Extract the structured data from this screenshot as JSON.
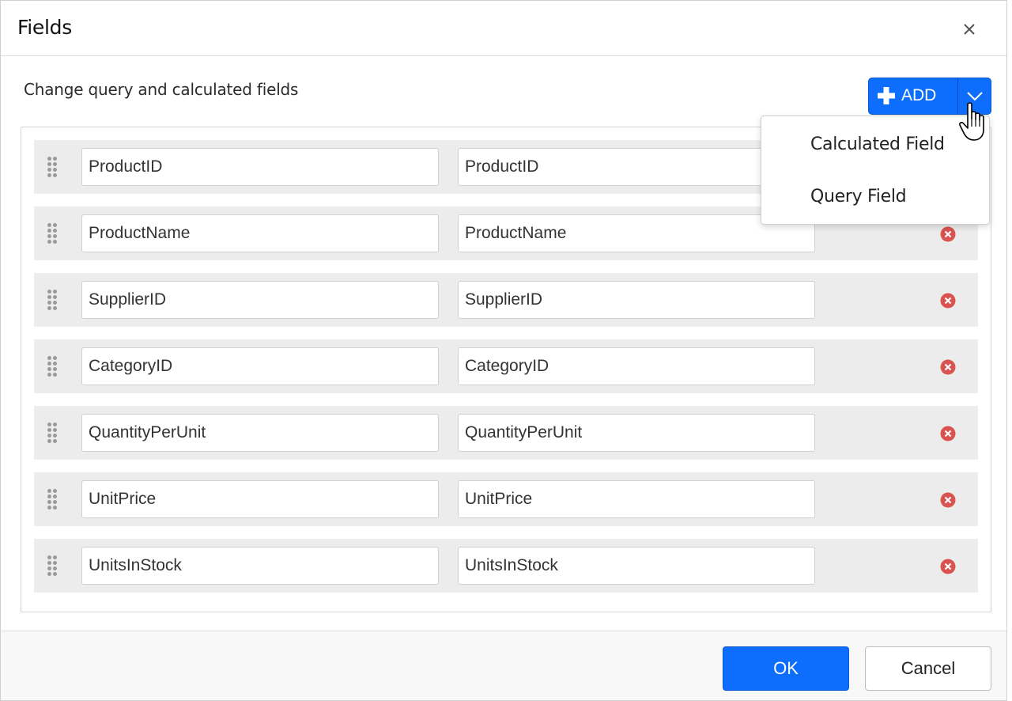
{
  "dialog": {
    "title": "Fields",
    "subtitle": "Change query and calculated fields"
  },
  "add_button": {
    "label": "ADD"
  },
  "dropdown": {
    "items": [
      {
        "label": "Calculated Field"
      },
      {
        "label": "Query Field"
      }
    ]
  },
  "fields": [
    {
      "name": "ProductID",
      "alias": "ProductID"
    },
    {
      "name": "ProductName",
      "alias": "ProductName"
    },
    {
      "name": "SupplierID",
      "alias": "SupplierID"
    },
    {
      "name": "CategoryID",
      "alias": "CategoryID"
    },
    {
      "name": "QuantityPerUnit",
      "alias": "QuantityPerUnit"
    },
    {
      "name": "UnitPrice",
      "alias": "UnitPrice"
    },
    {
      "name": "UnitsInStock",
      "alias": "UnitsInStock"
    }
  ],
  "footer": {
    "ok_label": "OK",
    "cancel_label": "Cancel"
  },
  "colors": {
    "primary": "#0d6efd",
    "remove_icon": "#d9534f",
    "row_background": "#ececec"
  },
  "icons": {
    "close": "close-icon",
    "add": "plus-icon",
    "caret": "chevron-down-icon",
    "drag": "drag-handle-icon",
    "remove": "remove-circle-icon",
    "cursor": "hand-pointer-icon"
  }
}
